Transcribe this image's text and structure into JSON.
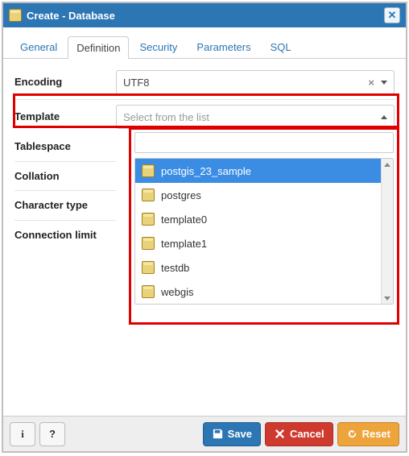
{
  "dialog": {
    "title": "Create - Database"
  },
  "tabs": {
    "general": "General",
    "definition": "Definition",
    "security": "Security",
    "parameters": "Parameters",
    "sql": "SQL"
  },
  "labels": {
    "encoding": "Encoding",
    "template": "Template",
    "tablespace": "Tablespace",
    "collation": "Collation",
    "character_type": "Character type",
    "connection_limit": "Connection limit"
  },
  "encoding": {
    "value": "UTF8"
  },
  "template": {
    "placeholder": "Select from the list",
    "options": [
      "postgis_23_sample",
      "postgres",
      "template0",
      "template1",
      "testdb",
      "webgis"
    ],
    "selected_index": 0
  },
  "footer": {
    "save": "Save",
    "cancel": "Cancel",
    "reset": "Reset"
  }
}
